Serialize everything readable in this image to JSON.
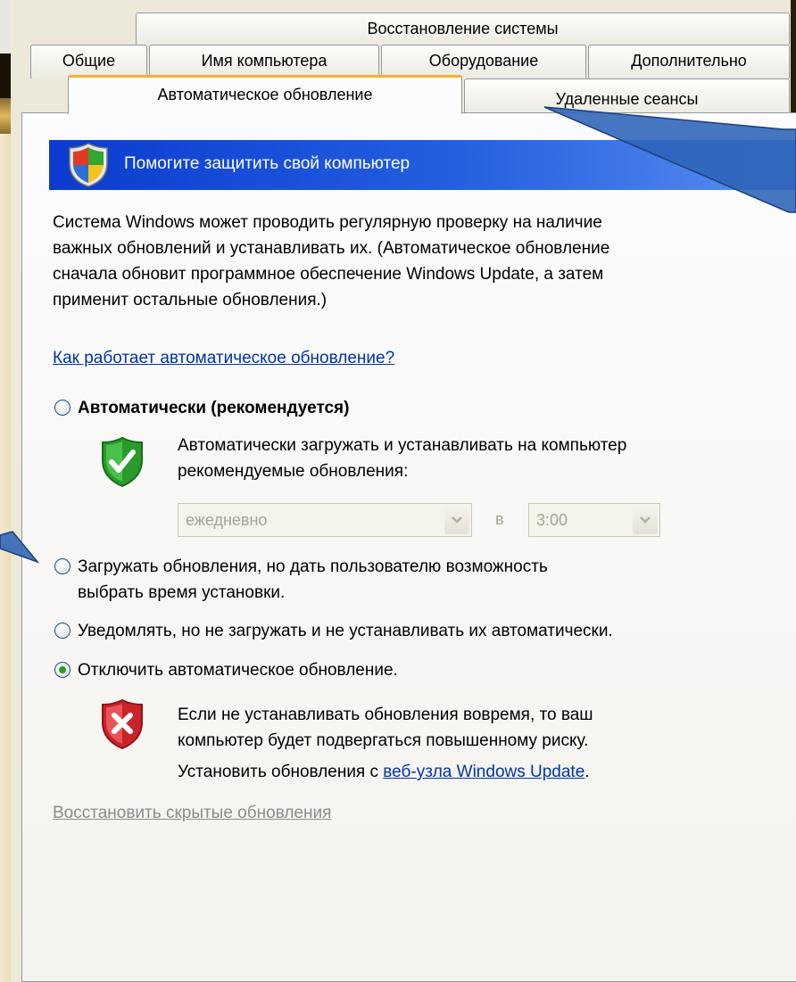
{
  "tabs": {
    "row1": [
      "Восстановление системы"
    ],
    "row2": [
      "Общие",
      "Имя компьютера",
      "Оборудование",
      "Дополнительно"
    ],
    "row3": [
      "Автоматическое обновление",
      "Удаленные сеансы"
    ],
    "selected": "Автоматическое обновление"
  },
  "banner": {
    "title": "Помогите защитить свой компьютер",
    "icon": "windows-security-shield-icon"
  },
  "intro": [
    "Система Windows может проводить регулярную проверку на наличие",
    "важных обновлений и устанавливать их. (Автоматическое обновление",
    "сначала обновит программное обеспечение Windows Update, а затем",
    "применит остальные обновления.)"
  ],
  "help_link": "Как работает автоматическое обновление?",
  "options": {
    "auto": {
      "label": "Автоматически (рекомендуется)",
      "checked": false,
      "desc_line1": "Автоматически загружать и устанавливать на компьютер",
      "desc_line2": "рекомендуемые обновления:",
      "icon": "green-check-shield-icon",
      "frequency_value": "ежедневно",
      "in_label": "в",
      "time_value": "3:00"
    },
    "download": {
      "line1": "Загружать обновления, но дать пользователю возможность",
      "line2": "выбрать время установки.",
      "checked": false
    },
    "notify": {
      "label": "Уведомлять, но не загружать и не устанавливать их автоматически.",
      "checked": false
    },
    "off": {
      "label": "Отключить автоматическое обновление.",
      "checked": true,
      "warning_line1": "Если не устанавливать обновления вовремя, то ваш",
      "warning_line2": "компьютер будет подвергаться повышенному риску.",
      "install_prefix": "Установить обновления с ",
      "install_link": "веб-узла Windows Update",
      "install_suffix": ".",
      "icon": "red-x-shield-icon"
    }
  },
  "restore_hidden_link": "Восстановить скрытые обновления",
  "colors": {
    "banner": "#0b3bcf",
    "selected_tab_accent": "#f8b030",
    "link": "#0033aa",
    "callout": "#2e63b8"
  }
}
